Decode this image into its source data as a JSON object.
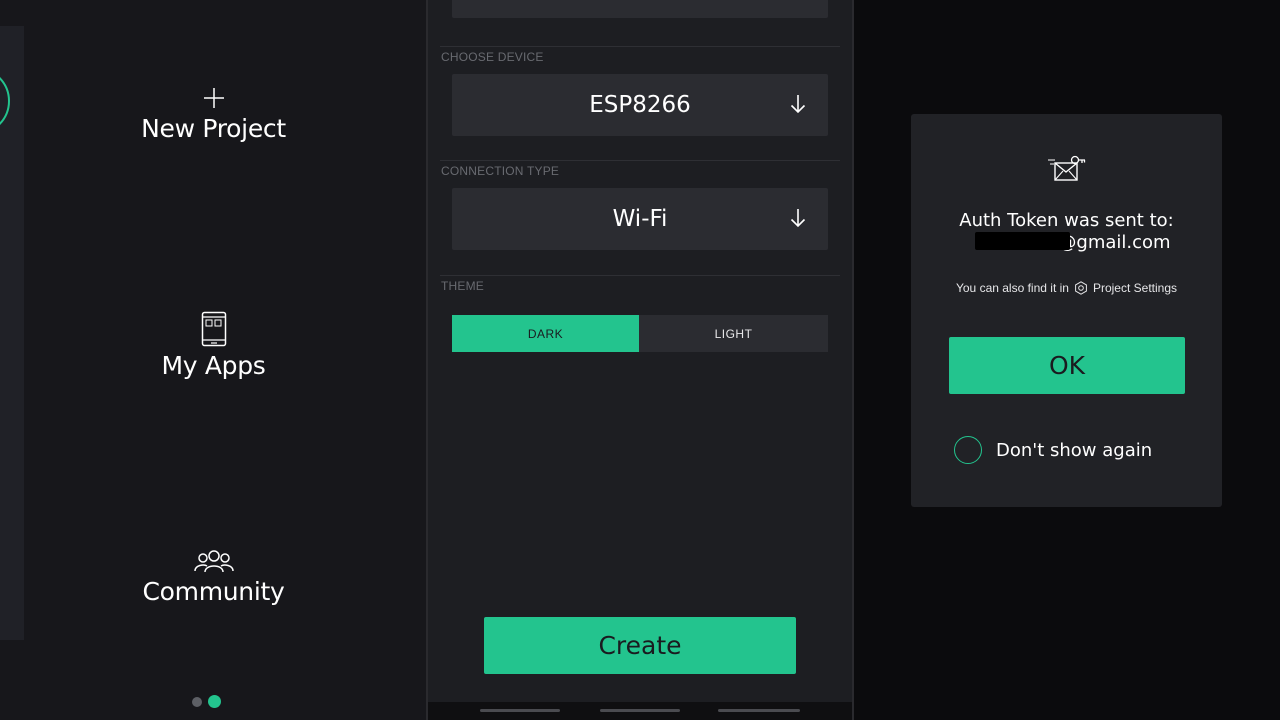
{
  "left": {
    "new_project": {
      "label": "New Project",
      "icon": "plus-icon"
    },
    "my_apps": {
      "label": "My Apps",
      "icon": "phone-icon"
    },
    "community": {
      "label": "Community",
      "icon": "people-icon"
    },
    "pager": {
      "count": 2,
      "active": 2
    }
  },
  "create_project": {
    "choose_device_label": "CHOOSE DEVICE",
    "device_value": "ESP8266",
    "connection_type_label": "CONNECTION TYPE",
    "connection_value": "Wi-Fi",
    "theme_label": "THEME",
    "theme_dark": "DARK",
    "theme_light": "LIGHT",
    "theme_selected": "DARK",
    "create_label": "Create"
  },
  "dialog": {
    "icon": "mail-key-icon",
    "title": "Auth Token was sent to:",
    "email": "@gmail.com",
    "hint_prefix": "You can also find it in",
    "hint_link": "Project Settings",
    "ok_label": "OK",
    "dont_show_label": "Don't show again"
  },
  "colors": {
    "accent": "#23c48e",
    "panel": "#1d1e22",
    "field": "#2b2c31",
    "dialog": "#212226"
  }
}
